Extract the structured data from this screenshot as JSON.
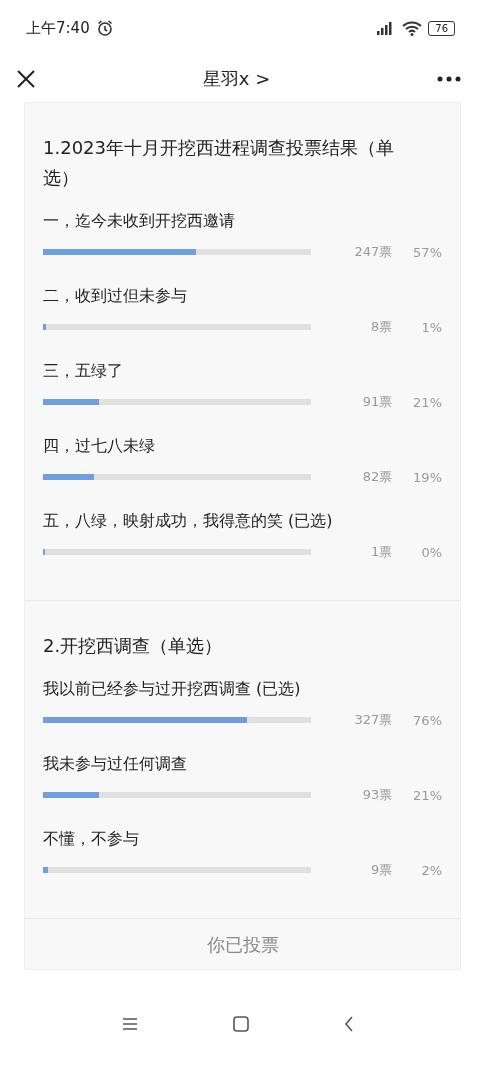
{
  "status_bar": {
    "time": "上午7:40",
    "battery": "76"
  },
  "header": {
    "title": "星羽x >"
  },
  "questions": [
    {
      "title": "1.2023年十月开挖西进程调查投票结果（单选）",
      "options": [
        {
          "label": "一，迄今未收到开挖西邀请",
          "level": 0.57,
          "votes": "247票",
          "percent": "57%"
        },
        {
          "label": "二，收到过但未参与",
          "level": 0.01,
          "votes": "8票",
          "percent": "1%"
        },
        {
          "label": "三，五绿了",
          "level": 0.21,
          "votes": "91票",
          "percent": "21%"
        },
        {
          "label": "四，过七八未绿",
          "level": 0.19,
          "votes": "82票",
          "percent": "19%"
        },
        {
          "label": "五，八绿，映射成功，我得意的笑 (已选)",
          "level": 0.0,
          "votes": "1票",
          "percent": "0%"
        }
      ]
    },
    {
      "title": "2.开挖西调查（单选）",
      "options": [
        {
          "label": "我以前已经参与过开挖西调查 (已选)",
          "level": 0.76,
          "votes": "327票",
          "percent": "76%"
        },
        {
          "label": "我未参与过任何调查",
          "level": 0.21,
          "votes": "93票",
          "percent": "21%"
        },
        {
          "label": "不懂，不参与",
          "level": 0.02,
          "votes": "9票",
          "percent": "2%"
        }
      ]
    }
  ],
  "footer": {
    "text": "你已投票"
  }
}
